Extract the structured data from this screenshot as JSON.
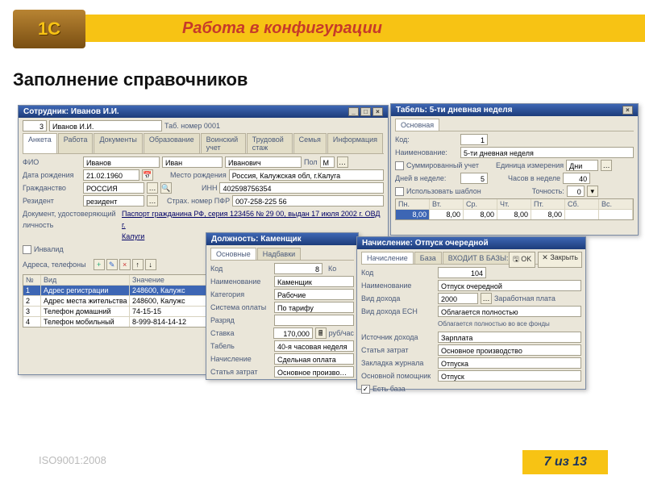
{
  "banner": {
    "title": "Работа в конфигурации",
    "logo": "1С"
  },
  "subtitle": "Заполнение справочников",
  "footer": {
    "iso": "ISO9001:2008",
    "counter": "7 из 13"
  },
  "employee": {
    "title": "Сотрудник: Иванов И.И.",
    "code": "3",
    "name": "Иванов И.И.",
    "tabno_label": "Таб. номер 0001",
    "tabs": [
      "Анкета",
      "Работа",
      "Документы",
      "Образование",
      "Воинский учет",
      "Трудовой стаж",
      "Семья",
      "Информация"
    ],
    "fio_label": "ФИО",
    "last": "Иванов",
    "first": "Иван",
    "mid": "Иванович",
    "pol_label": "Пол",
    "pol": "М",
    "dob_label": "Дата рождения",
    "dob": "21.02.1960",
    "birthplace_label": "Место рождения",
    "birthplace": "Россия, Калужская обл, г.Калуга",
    "citizenship_label": "Гражданство",
    "citizenship": "РОССИЯ",
    "inn_label": "ИНН",
    "inn": "402598756354",
    "resident_label": "Резидент",
    "resident": "резидент",
    "pfr_label": "Страх. номер ПФР",
    "pfr": "007-258-225 56",
    "doc_label": "Документ, удостоверяющий личность",
    "doc_link1": "Паспорт гражданина РФ, серия 123456 № 29 00, выдан 17 июля 2002 г. ОВД г.",
    "doc_link2": "Калуги",
    "invalid_label": "Инвалид",
    "addr_section": "Адреса, телефоны",
    "grid_headers": [
      "№",
      "Вид",
      "Значение"
    ],
    "grid_rows": [
      [
        "1",
        "Адрес регистрации",
        "248600, Калужс"
      ],
      [
        "2",
        "Адрес места жительства",
        "248600, Калужс"
      ],
      [
        "3",
        "Телефон домашний",
        "74-15-15"
      ],
      [
        "4",
        "Телефон мобильный",
        "8-999-814-14-12"
      ]
    ]
  },
  "tabel": {
    "title": "Табель: 5-ти дневная неделя",
    "tab_main": "Основная",
    "code_label": "Код:",
    "code": "1",
    "name_label": "Наименование:",
    "name": "5-ти дневная неделя",
    "summ_label": "Суммированный учет",
    "unit_label": "Единица измерения",
    "unit": "Дни",
    "days_label": "Дней в неделе:",
    "days": "5",
    "hours_label": "Часов в неделе",
    "hours": "40",
    "tpl_label": "Использовать шаблон",
    "precision_label": "Точность:",
    "precision": "0",
    "week_headers": [
      "Пн.",
      "Вт.",
      "Ср.",
      "Чт.",
      "Пт.",
      "Сб.",
      "Вс."
    ],
    "week_values": [
      "8,00",
      "8,00",
      "8,00",
      "8,00",
      "8,00",
      "",
      ""
    ]
  },
  "position": {
    "title": "Должность: Каменщик",
    "tabs": [
      "Основные",
      "Надбавки"
    ],
    "code_label": "Код",
    "code": "8",
    "name_label": "Наименование",
    "name": "Каменщик",
    "cat_label": "Категория",
    "cat": "Рабочие",
    "pay_label": "Система оплаты",
    "pay": "По тарифу",
    "grade_label": "Разряд",
    "grade": "",
    "rate_label": "Ставка",
    "rate": "170,000",
    "rate_unit": "руб/час",
    "tabel_label": "Табель",
    "tabel": "40-я часовая неделя",
    "accr_label": "Начисление",
    "accr": "Сдельная оплата",
    "cost_label": "Статья затрат",
    "cost": "Основное производство"
  },
  "calc": {
    "title": "Начисление: Отпуск очередной",
    "tabs": [
      "Начисление",
      "База",
      "ВХОДИТ В БАЗЫ:"
    ],
    "code_label": "Код",
    "code": "104",
    "name_label": "Наименование",
    "name": "Отпуск очередной",
    "income_label": "Вид дохода",
    "income": "2000",
    "income_note": "Заработная плата",
    "esn_label": "Вид дохода ЕСН",
    "esn": "Облагается полностью",
    "esn_note": "Облагается полностью во все фонды",
    "src_label": "Источник дохода",
    "src": "Зарплата",
    "cost_label": "Статья затрат",
    "cost": "Основное производство",
    "journal_label": "Закладка журнала",
    "journal": "Отпуска",
    "helper_label": "Основной помощник",
    "helper": "Отпуск",
    "hasbase_label": "Есть база",
    "ok": "OK",
    "close": "Закрыть"
  }
}
